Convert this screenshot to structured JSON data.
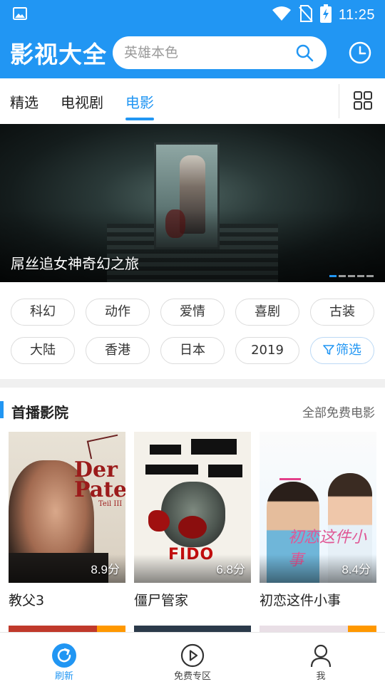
{
  "status_bar": {
    "time": "11:25"
  },
  "header": {
    "app_title": "影视大全",
    "search_placeholder": "英雄本色"
  },
  "tabs": [
    {
      "label": "精选",
      "active": false
    },
    {
      "label": "电视剧",
      "active": false
    },
    {
      "label": "电影",
      "active": true
    }
  ],
  "banner": {
    "title": "屌丝追女神奇幻之旅",
    "dots": 5,
    "active_dot": 0
  },
  "tags": [
    "科幻",
    "动作",
    "爱情",
    "喜剧",
    "古装",
    "大陆",
    "香港",
    "日本",
    "2019"
  ],
  "filter_label": "筛选",
  "section": {
    "title": "首播影院",
    "link": "全部免费电影"
  },
  "movies": [
    {
      "title": "教父3",
      "rating": "8.9分",
      "poster_text": "Der Pate",
      "poster_sub": "Teil III"
    },
    {
      "title": "僵尸管家",
      "rating": "6.8分",
      "poster_text": "FIDO"
    },
    {
      "title": "初恋这件小事",
      "rating": "8.4分",
      "poster_text": "初恋这件小事"
    }
  ],
  "bottom_nav": [
    {
      "label": "刷新",
      "icon": "refresh-icon",
      "active": true
    },
    {
      "label": "免费专区",
      "icon": "play-circle-icon",
      "active": false
    },
    {
      "label": "我",
      "icon": "user-icon",
      "active": false
    }
  ],
  "colors": {
    "accent": "#2196f3",
    "badge": "#ff9800"
  }
}
